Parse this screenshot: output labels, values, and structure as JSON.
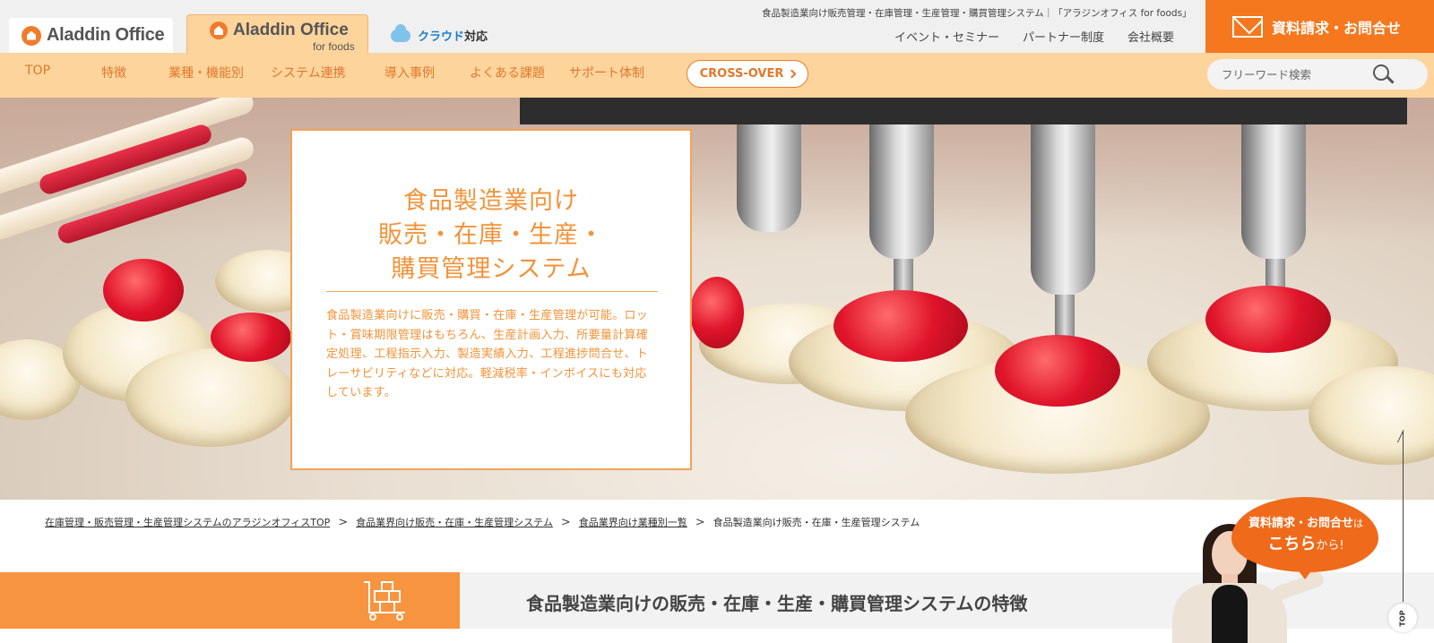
{
  "header": {
    "logo_main": "Aladdin Office",
    "logo_foods_main": "Aladdin Office",
    "logo_foods_sub": "for foods",
    "cloud_label_blue": "クラウド",
    "cloud_label_rest": "対応",
    "tagline": "食品製造業向け販売管理・在庫管理・生産管理・購買管理システム｜「アラジンオフィス for foods」",
    "util_links": [
      "イベント・セミナー",
      "パートナー制度",
      "会社概要"
    ],
    "contact_label": "資料請求・お問合せ"
  },
  "nav": {
    "items": [
      "TOP",
      "特徴",
      "業種・機能別",
      "システム連携",
      "導入事例",
      "よくある課題",
      "サポート体制"
    ],
    "crossover_label": "CROSS-OVER",
    "search_placeholder": "フリーワード検索"
  },
  "hero": {
    "title_lines": [
      "食品製造業向け",
      "販売・在庫・生産・",
      "購買管理システム"
    ],
    "description": "食品製造業向けに販売・購買・在庫・生産管理が可能。ロット・賞味期限管理はもちろん、生産計画入力、所要量計算確定処理、工程指示入力、製造実績入力、工程進捗問合せ、トレーサビリティなどに対応。軽減税率・インボイスにも対応しています。"
  },
  "breadcrumb": {
    "items": [
      "在庫管理・販売管理・生産管理システムのアラジンオフィスTOP",
      "食品業界向け販売・在庫・生産管理システム",
      "食品業界向け業種別一覧",
      "食品製造業向け販売・在庫・生産管理システム"
    ]
  },
  "section": {
    "title": "食品製造業向けの販売・在庫・生産・購買管理システムの特徴"
  },
  "floating": {
    "bubble_line1": "資料請求・お問合せ",
    "bubble_line1_small": "は",
    "bubble_line2": "こちら",
    "bubble_line2_small": "から!",
    "top_label": "TOP"
  },
  "colors": {
    "accent_orange": "#f5781e",
    "nav_bg": "#fdd49c",
    "title_orange": "#f2933a"
  }
}
